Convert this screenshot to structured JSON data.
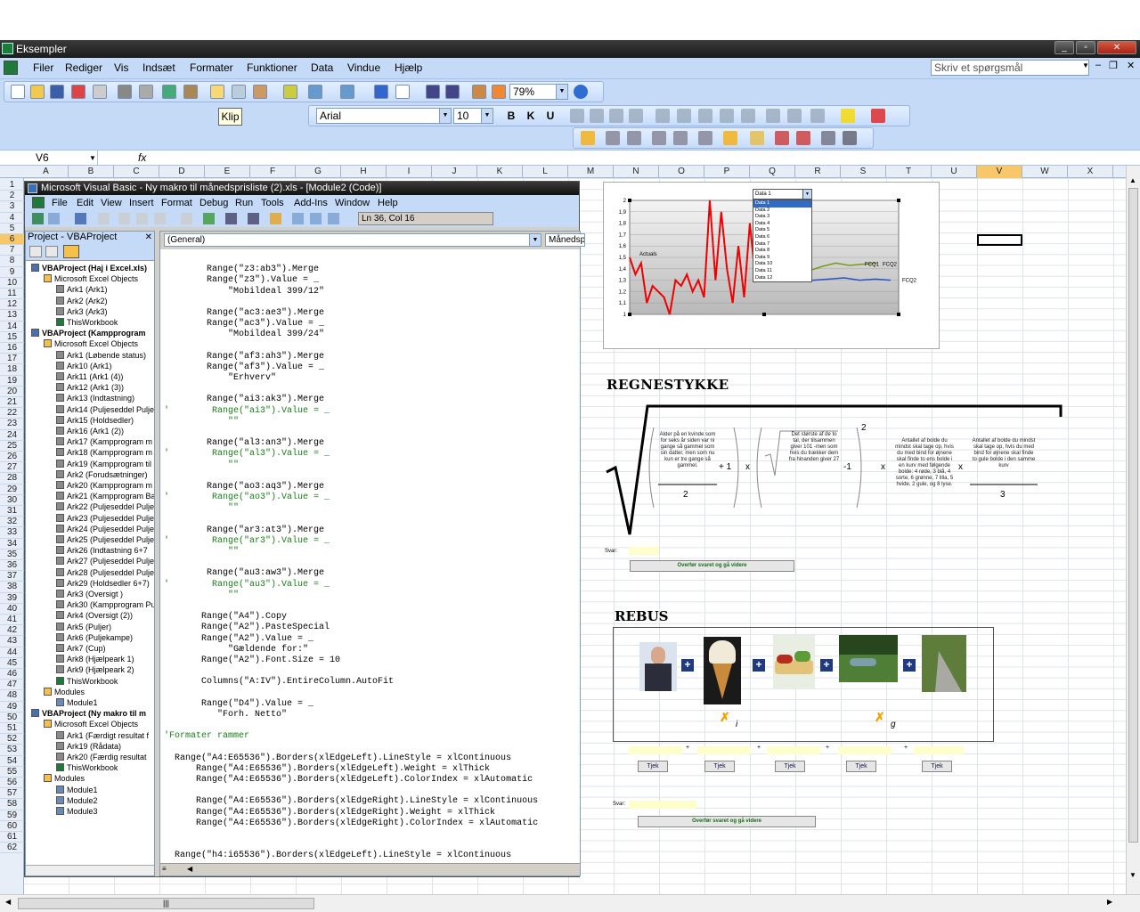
{
  "window": {
    "title": "Eksempler"
  },
  "menu": [
    "Filer",
    "Rediger",
    "Vis",
    "Indsæt",
    "Formater",
    "Funktioner",
    "Data",
    "Vindue",
    "Hjælp"
  ],
  "help_placeholder": "Skriv et spørgsmål",
  "toolbar": {
    "zoom": "79%",
    "tooltip": "Klip",
    "font": "Arial",
    "size": "10"
  },
  "formula": {
    "namebox": "V6",
    "fx": "fx"
  },
  "columns": [
    "A",
    "B",
    "C",
    "D",
    "E",
    "F",
    "G",
    "H",
    "I",
    "J",
    "K",
    "L",
    "M",
    "N",
    "O",
    "P",
    "Q",
    "R",
    "S",
    "T",
    "U",
    "V",
    "W",
    "X"
  ],
  "rows": [
    "1",
    "2",
    "3",
    "4",
    "5",
    "6",
    "7",
    "8",
    "9",
    "10",
    "11",
    "12",
    "13",
    "14",
    "15",
    "16",
    "17",
    "18",
    "19",
    "20",
    "21",
    "22",
    "23",
    "24",
    "25",
    "26",
    "27",
    "28",
    "29",
    "30",
    "31",
    "32",
    "33",
    "34",
    "35",
    "36",
    "37",
    "38",
    "39",
    "40",
    "41",
    "42",
    "43",
    "44",
    "45",
    "46",
    "47",
    "48",
    "49",
    "50",
    "51",
    "52",
    "53",
    "54",
    "55",
    "56",
    "57",
    "58",
    "59",
    "60",
    "61",
    "62"
  ],
  "vbe": {
    "title": "Microsoft Visual Basic - Ny makro til månedsprisliste (2).xls - [Module2 (Code)]",
    "menu": [
      "File",
      "Edit",
      "View",
      "Insert",
      "Format",
      "Debug",
      "Run",
      "Tools",
      "Add-Ins",
      "Window",
      "Help"
    ],
    "position": "Ln 36, Col 16",
    "project_title": "Project - VBAProject",
    "general": "(General)",
    "proc": "Månedspr",
    "tree": [
      {
        "t": "VBAProject (Haj i Excel.xls)",
        "d": 0,
        "b": true,
        "i": "proj"
      },
      {
        "t": "Microsoft Excel Objects",
        "d": 1,
        "i": "folder"
      },
      {
        "t": "Ark1 (Ark1)",
        "d": 2,
        "i": "sheet"
      },
      {
        "t": "Ark2 (Ark2)",
        "d": 2,
        "i": "sheet"
      },
      {
        "t": "Ark3 (Ark3)",
        "d": 2,
        "i": "sheet"
      },
      {
        "t": "ThisWorkbook",
        "d": 2,
        "i": "wb"
      },
      {
        "t": "VBAProject (Kampprogram",
        "d": 0,
        "b": true,
        "i": "proj"
      },
      {
        "t": "Microsoft Excel Objects",
        "d": 1,
        "i": "folder"
      },
      {
        "t": "Ark1 (Løbende status)",
        "d": 2,
        "i": "sheet"
      },
      {
        "t": "Ark10 (Ark1)",
        "d": 2,
        "i": "sheet"
      },
      {
        "t": "Ark11 (Ark1 (4))",
        "d": 2,
        "i": "sheet"
      },
      {
        "t": "Ark12 (Ark1 (3))",
        "d": 2,
        "i": "sheet"
      },
      {
        "t": "Ark13 (Indtastning)",
        "d": 2,
        "i": "sheet"
      },
      {
        "t": "Ark14 (Puljeseddel Pulje",
        "d": 2,
        "i": "sheet"
      },
      {
        "t": "Ark15 (Holdsedler)",
        "d": 2,
        "i": "sheet"
      },
      {
        "t": "Ark16 (Ark1 (2))",
        "d": 2,
        "i": "sheet"
      },
      {
        "t": "Ark17 (Kampprogram m",
        "d": 2,
        "i": "sheet"
      },
      {
        "t": "Ark18 (Kampprogram m",
        "d": 2,
        "i": "sheet"
      },
      {
        "t": "Ark19 (Kampprogram til",
        "d": 2,
        "i": "sheet"
      },
      {
        "t": "Ark2 (Forudsætninger)",
        "d": 2,
        "i": "sheet"
      },
      {
        "t": "Ark20 (Kampprogram m",
        "d": 2,
        "i": "sheet"
      },
      {
        "t": "Ark21 (Kampprogram Ba",
        "d": 2,
        "i": "sheet"
      },
      {
        "t": "Ark22 (Puljeseddel Pulje",
        "d": 2,
        "i": "sheet"
      },
      {
        "t": "Ark23 (Puljeseddel Pulje",
        "d": 2,
        "i": "sheet"
      },
      {
        "t": "Ark24 (Puljeseddel Pulje",
        "d": 2,
        "i": "sheet"
      },
      {
        "t": "Ark25 (Puljeseddel Pulje",
        "d": 2,
        "i": "sheet"
      },
      {
        "t": "Ark26 (Indtastning 6+7",
        "d": 2,
        "i": "sheet"
      },
      {
        "t": "Ark27 (Puljeseddel Pulje",
        "d": 2,
        "i": "sheet"
      },
      {
        "t": "Ark28 (Puljeseddel Pulje",
        "d": 2,
        "i": "sheet"
      },
      {
        "t": "Ark29 (Holdsedler 6+7)",
        "d": 2,
        "i": "sheet"
      },
      {
        "t": "Ark3 (Oversigt )",
        "d": 2,
        "i": "sheet"
      },
      {
        "t": "Ark30 (Kampprogram Pu",
        "d": 2,
        "i": "sheet"
      },
      {
        "t": "Ark4 (Oversigt  (2))",
        "d": 2,
        "i": "sheet"
      },
      {
        "t": "Ark5 (Puljer)",
        "d": 2,
        "i": "sheet"
      },
      {
        "t": "Ark6 (Puljekampe)",
        "d": 2,
        "i": "sheet"
      },
      {
        "t": "Ark7 (Cup)",
        "d": 2,
        "i": "sheet"
      },
      {
        "t": "Ark8 (Hjælpeark 1)",
        "d": 2,
        "i": "sheet"
      },
      {
        "t": "Ark9 (Hjælpeark 2)",
        "d": 2,
        "i": "sheet"
      },
      {
        "t": "ThisWorkbook",
        "d": 2,
        "i": "wb"
      },
      {
        "t": "Modules",
        "d": 1,
        "i": "folder"
      },
      {
        "t": "Module1",
        "d": 2,
        "i": "mod"
      },
      {
        "t": "VBAProject (Ny makro til m",
        "d": 0,
        "b": true,
        "i": "proj"
      },
      {
        "t": "Microsoft Excel Objects",
        "d": 1,
        "i": "folder"
      },
      {
        "t": "Ark1 (Færdigt resultat f",
        "d": 2,
        "i": "sheet"
      },
      {
        "t": "Ark19 (Rådata)",
        "d": 2,
        "i": "sheet"
      },
      {
        "t": "Ark20 (Færdig resultat",
        "d": 2,
        "i": "sheet"
      },
      {
        "t": "ThisWorkbook",
        "d": 2,
        "i": "wb"
      },
      {
        "t": "Modules",
        "d": 1,
        "i": "folder"
      },
      {
        "t": "Module1",
        "d": 2,
        "i": "mod"
      },
      {
        "t": "Module2",
        "d": 2,
        "i": "mod"
      },
      {
        "t": "Module3",
        "d": 2,
        "i": "mod"
      }
    ],
    "code": [
      {
        "t": ""
      },
      {
        "t": "        Range(\"z3:ab3\").Merge"
      },
      {
        "t": "        Range(\"z3\").Value = _"
      },
      {
        "t": "            \"Mobildeal 399/12\""
      },
      {
        "t": ""
      },
      {
        "t": "        Range(\"ac3:ae3\").Merge"
      },
      {
        "t": "        Range(\"ac3\").Value = _"
      },
      {
        "t": "            \"Mobildeal 399/24\""
      },
      {
        "t": ""
      },
      {
        "t": "        Range(\"af3:ah3\").Merge"
      },
      {
        "t": "        Range(\"af3\").Value = _"
      },
      {
        "t": "            \"Erhverv\""
      },
      {
        "t": ""
      },
      {
        "t": "        Range(\"ai3:ak3\").Merge"
      },
      {
        "t": "'        Range(\"ai3\").Value = _",
        "c": true
      },
      {
        "t": "            \"\"",
        "c": true
      },
      {
        "t": ""
      },
      {
        "t": "        Range(\"al3:an3\").Merge"
      },
      {
        "t": "'        Range(\"al3\").Value = _",
        "c": true
      },
      {
        "t": "            \"\"",
        "c": true
      },
      {
        "t": ""
      },
      {
        "t": "        Range(\"ao3:aq3\").Merge"
      },
      {
        "t": "'        Range(\"ao3\").Value = _",
        "c": true
      },
      {
        "t": "            \"\"",
        "c": true
      },
      {
        "t": ""
      },
      {
        "t": "        Range(\"ar3:at3\").Merge"
      },
      {
        "t": "'        Range(\"ar3\").Value = _",
        "c": true
      },
      {
        "t": "            \"\"",
        "c": true
      },
      {
        "t": ""
      },
      {
        "t": "        Range(\"au3:aw3\").Merge"
      },
      {
        "t": "'        Range(\"au3\").Value = _",
        "c": true
      },
      {
        "t": "            \"\"",
        "c": true
      },
      {
        "t": ""
      },
      {
        "t": "       Range(\"A4\").Copy"
      },
      {
        "t": "       Range(\"A2\").PasteSpecial"
      },
      {
        "t": "       Range(\"A2\").Value = _"
      },
      {
        "t": "            \"Gældende for:\""
      },
      {
        "t": "       Range(\"A2\").Font.Size = 10"
      },
      {
        "t": ""
      },
      {
        "t": "       Columns(\"A:IV\").EntireColumn.AutoFit"
      },
      {
        "t": ""
      },
      {
        "t": "       Range(\"D4\").Value = _"
      },
      {
        "t": "          \"Forh. Netto\""
      },
      {
        "t": ""
      },
      {
        "t": "'Formater rammer",
        "c": true
      },
      {
        "t": ""
      },
      {
        "t": "  Range(\"A4:E65536\").Borders(xlEdgeLeft).LineStyle = xlContinuous"
      },
      {
        "t": "      Range(\"A4:E65536\").Borders(xlEdgeLeft).Weight = xlThick"
      },
      {
        "t": "      Range(\"A4:E65536\").Borders(xlEdgeLeft).ColorIndex = xlAutomatic"
      },
      {
        "t": ""
      },
      {
        "t": "      Range(\"A4:E65536\").Borders(xlEdgeRight).LineStyle = xlContinuous"
      },
      {
        "t": "      Range(\"A4:E65536\").Borders(xlEdgeRight).Weight = xlThick"
      },
      {
        "t": "      Range(\"A4:E65536\").Borders(xlEdgeRight).ColorIndex = xlAutomatic"
      },
      {
        "t": ""
      },
      {
        "t": ""
      },
      {
        "t": "  Range(\"h4:i65536\").Borders(xlEdgeLeft).LineStyle = xlContinuous"
      }
    ]
  },
  "chart": {
    "dropdown": "Data 1",
    "options": [
      "Data 1",
      "Data 2",
      "Data 3",
      "Data 4",
      "Data 5",
      "Data 6",
      "Data 7",
      "Data 8",
      "Data 9",
      "Data 10",
      "Data 11",
      "Data 12"
    ],
    "labels": {
      "actuals": "Actuals",
      "fcq1": "FCQ1",
      "fcq2": "FCQ2",
      "fcq2b": "FCQ2"
    },
    "yticks": [
      "2",
      "1,9",
      "1,8",
      "1,7",
      "1,6",
      "1,5",
      "1,4",
      "1,3",
      "1,2",
      "1,1",
      "1"
    ]
  },
  "chart_data": {
    "type": "line",
    "ylim": [
      1,
      2
    ],
    "series": [
      {
        "name": "Actuals",
        "values": [
          1.5,
          1.35,
          1.45,
          1.1,
          1.25,
          1.2,
          1.15,
          1.0,
          1.3,
          1.25,
          1.35,
          1.2,
          1.3,
          1.15,
          2.0,
          1.3,
          1.9,
          1.4,
          1.1,
          1.6,
          1.15,
          1.8,
          1.3,
          1.4,
          1.3
        ]
      },
      {
        "name": "FCQ1",
        "values": [
          1.4,
          1.4,
          1.4,
          1.38,
          1.42,
          1.45,
          1.43,
          1.44,
          1.45
        ]
      },
      {
        "name": "FCQ2",
        "values": [
          1.3,
          1.3,
          1.3,
          1.3,
          1.31,
          1.32,
          1.3,
          1.31,
          1.3
        ]
      }
    ]
  },
  "regne": {
    "title": "REGNESTYKKE",
    "t1": "Alder på en kvinde som for seks år siden var ni gange så gammel som sin datter, men som nu kun er tre gange så gammel.",
    "d1": "2",
    "plus1": "+ 1",
    "x1": "x",
    "t2": "Det største af de to tal, der tilsammen giver 101 -men som hvis du trækker dem fra hinanden giver 27",
    "minus1": "-1",
    "exp": "2",
    "x2": "x",
    "t3": "Antallet af bolde du mindst skal tage op, hvis du med bind for øjnene skal finde to ens bolde i en kurv med følgende bolde: 4 røde, 3 blå, 4 sorte, 6 grønne, 7 lilla, 5 hvide, 2 gule, og 8 lyse.",
    "x3": "x",
    "t4": "Antallet af bolde du mindst skal tage op, hvis du med bind for øjnene skal finde to gule bolde i den samme kurv",
    "d4": "3",
    "svar": "Svar:",
    "button": "Overfør svaret og gå videre"
  },
  "rebus": {
    "title": "REBUS",
    "i": "i",
    "g": "g",
    "tjek": "Tjek",
    "svar": "Svar:",
    "button": "Overfør svaret og gå videre"
  }
}
